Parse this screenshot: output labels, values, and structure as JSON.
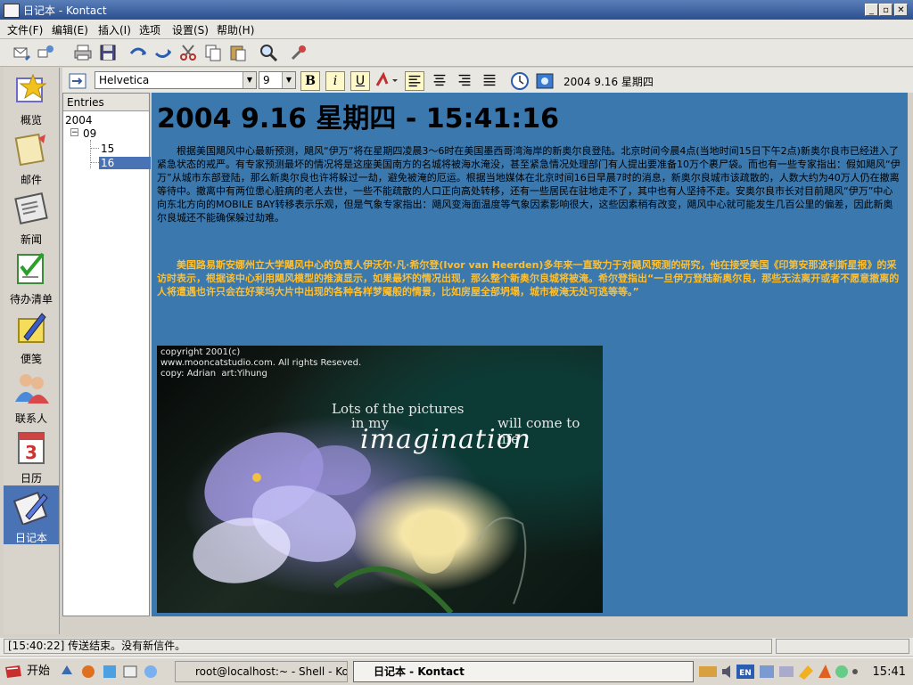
{
  "window": {
    "title": "日记本 - Kontact"
  },
  "menu": [
    "文件(F)",
    "编辑(E)",
    "插入(I)",
    "选项",
    "设置(S)",
    "帮助(H)"
  ],
  "sidebar": [
    {
      "label": "概览",
      "icon": "summary-icon"
    },
    {
      "label": "邮件",
      "icon": "mail-icon"
    },
    {
      "label": "新闻",
      "icon": "news-icon"
    },
    {
      "label": "待办清单",
      "icon": "todo-icon"
    },
    {
      "label": "便笺",
      "icon": "notes-icon"
    },
    {
      "label": "联系人",
      "icon": "contacts-icon"
    },
    {
      "label": "日历",
      "icon": "calendar-icon",
      "number": "3"
    },
    {
      "label": "日记本",
      "icon": "journal-icon",
      "active": true
    }
  ],
  "format": {
    "font": "Helvetica",
    "size": "9",
    "bold": "B",
    "italic": "i",
    "underline": "U",
    "date": "2004 9.16 星期四"
  },
  "tree": {
    "header": "Entries",
    "year": "2004",
    "expander": "−",
    "month": "09",
    "days": [
      "15",
      "16"
    ],
    "selected": "16"
  },
  "entry": {
    "heading": "2004 9.16 星期四 - 15:41:16",
    "para1": "根据美国飓风中心最新预测，飓风“伊万”将在星期四凌晨3～6时在美国墨西哥湾海岸的新奥尔良登陆。北京时间今晨4点(当地时间15日下午2点)新奥尔良市已经进入了紧急状态的戒严。有专家预测最坏的情况将是这座美国南方的名城将被海水淹没，甚至紧急情况处理部门有人提出要准备10万个裹尸袋。而也有一些专家指出：假如飓风“伊万”从城市东部登陆，那么新奥尔良也许将躲过一劫，避免被淹的厄运。根据当地媒体在北京时间16日早晨7时的消息，新奥尔良城市该疏散的，人数大约为40万人仍在撤离等待中。撤离中有两位患心脏病的老人去世，一些不能疏散的人口正向高处转移，还有一些居民在驻地走不了，其中也有人坚持不走。安奥尔良市长对目前飓风“伊万”中心向东北方向的MOBILE BAY转移表示乐观，但是气象专家指出：飓风变海面温度等气象因素影响很大，这些因素稍有改变，飓风中心就可能发生几百公里的偏差，因此新奥尔良城还不能确保躲过劫难。",
    "para2": "美国路易斯安娜州立大学飓风中心的负责人伊沃尔·凡·希尔登(Ivor van Heerden)多年来一直致力于对飓风预测的研究，他在接受美国《印第安那波利斯星报》的采访时表示，根据该中心利用飓风模型的推演显示，如果最坏的情况出现，那么整个新奥尔良城将被淹。希尔登指出“一旦伊万登陆新奥尔良，那些无法离开或者不愿意撤离的人将遭遇也许只会在好莱坞大片中出现的各种各样梦魇般的情景，比如房屋全部坍塌，城市被淹无处可逃等等。”"
  },
  "picture": {
    "copyright": "copyright 2001(c)\nwww.mooncatstudio.com. All rights Reseved.\ncopy: Adrian  art:Yihung",
    "line1": "Lots of the pictures",
    "line2": "in my",
    "line3": "will come to life",
    "word": "imagination"
  },
  "status": {
    "text": "[15:40:22] 传送结束。没有新信件。"
  },
  "taskbar": {
    "start": "开始",
    "tasks": [
      {
        "label": "root@localhost:~ - Shell - Kon",
        "active": false
      },
      {
        "label": "日记本 - Kontact",
        "active": true
      }
    ],
    "ime": "EN",
    "clock": "15:41"
  },
  "colors": {
    "editor_bg": "#3a78ae",
    "highlight_text": "#ffbf2e",
    "selection": "#4a73b5"
  }
}
